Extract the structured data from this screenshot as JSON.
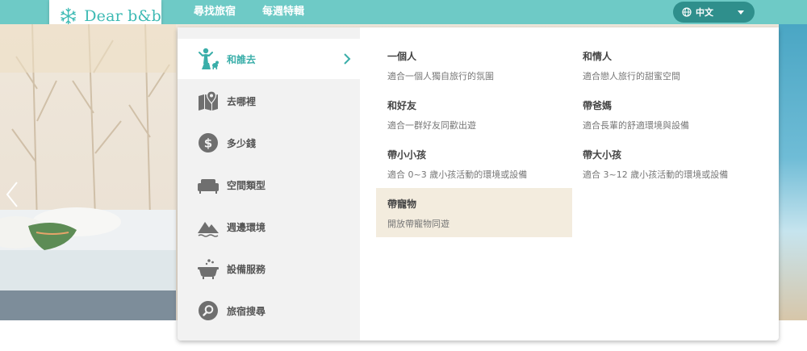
{
  "header": {
    "logo_text": "Dear b&b",
    "nav": [
      {
        "label": "尋找旅宿"
      },
      {
        "label": "每週特輯"
      }
    ],
    "language": {
      "label": "中文"
    }
  },
  "colors": {
    "topbar": "#6ecac6",
    "brand": "#3dbab4",
    "active_text": "#3aaea9",
    "icon_gray": "#6f6f6f",
    "selected_option_bg": "#f3ecde"
  },
  "categories": [
    {
      "label": "和誰去",
      "icon": "family-icon",
      "active": true
    },
    {
      "label": "去哪裡",
      "icon": "map-icon",
      "active": false
    },
    {
      "label": "多少錢",
      "icon": "dollar-icon",
      "active": false
    },
    {
      "label": "空間類型",
      "icon": "sofa-icon",
      "active": false
    },
    {
      "label": "週邊環境",
      "icon": "mountain-icon",
      "active": false
    },
    {
      "label": "設備服務",
      "icon": "bathtub-icon",
      "active": false
    },
    {
      "label": "旅宿搜尋",
      "icon": "search-icon",
      "active": false
    }
  ],
  "options": [
    {
      "title": "一個人",
      "desc": "適合一個人獨自旅行的氛圍",
      "active": false
    },
    {
      "title": "和情人",
      "desc": "適合戀人旅行的甜蜜空間",
      "active": false
    },
    {
      "title": "和好友",
      "desc": "適合一群好友同歡出遊",
      "active": false
    },
    {
      "title": "帶爸媽",
      "desc": "適合長輩的舒適環境與設備",
      "active": false
    },
    {
      "title": "帶小小孩",
      "desc": "適合 0~3 歲小孩活動的環境或設備",
      "active": false
    },
    {
      "title": "帶大小孩",
      "desc": "適合 3~12 歲小孩活動的環境或設備",
      "active": false
    },
    {
      "title": "帶寵物",
      "desc": "開放帶寵物同遊",
      "active": true
    }
  ]
}
